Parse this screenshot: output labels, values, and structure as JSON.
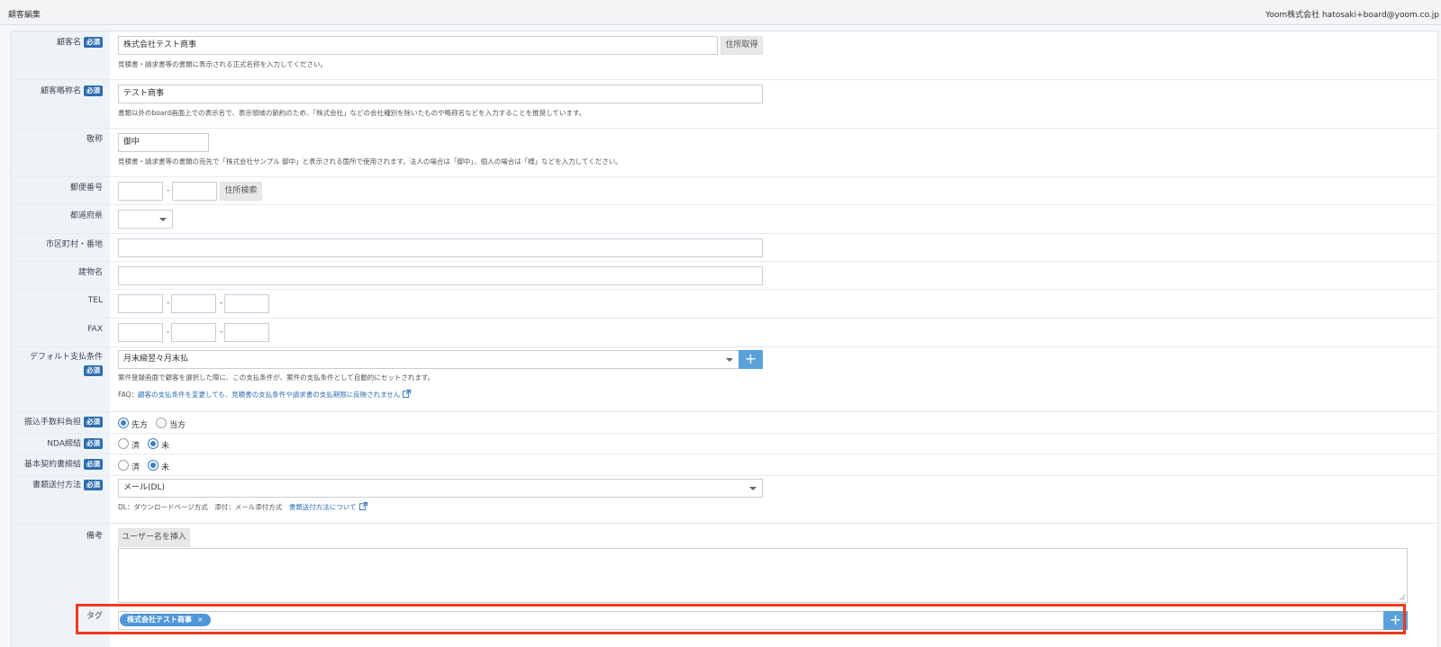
{
  "header": {
    "page_title": "顧客編集",
    "account": "Yoom株式会社 hatosaki+board@yoom.co.jp"
  },
  "required_label": "必須",
  "fields": {
    "customer_name": {
      "label": "顧客名",
      "value": "株式会社テスト商事",
      "button": "住所取得",
      "help": "見積書・請求書等の書類に表示される正式名称を入力してください。"
    },
    "short_name": {
      "label": "顧客略称名",
      "value": "テスト商事",
      "help": "書類以外のboard画面上での表示名で、表示領域の節約のため、「株式会社」などの会社種別を除いたものや略称名などを入力することを推奨しています。"
    },
    "honorific": {
      "label": "敬称",
      "value": "御中",
      "help": "見積書・請求書等の書類の宛先で「株式会社サンプル 御中」と表示される箇所で使用されます。法人の場合は「御中」、個人の場合は「様」などを入力してください。"
    },
    "postal_code": {
      "label": "郵便番号",
      "part1": "",
      "part2": "",
      "dash": "-",
      "button": "住所検索"
    },
    "prefecture": {
      "label": "都道府県",
      "value": ""
    },
    "city_address": {
      "label": "市区町村・番地",
      "value": ""
    },
    "building": {
      "label": "建物名",
      "value": ""
    },
    "tel": {
      "label": "TEL",
      "dash": "-"
    },
    "fax": {
      "label": "FAX",
      "dash": "-"
    },
    "payment_terms": {
      "label": "デフォルト支払条件",
      "value": "月末締翌々月末払",
      "plus": "+",
      "help": "案件登録画面で顧客を選択した際に、この支払条件が、案件の支払条件として自動的にセットされます。",
      "faq_prefix": "FAQ：",
      "faq_link": "顧客の支払条件を変更しても、見積書の支払条件や請求書の支払期限に反映されません"
    },
    "transfer_fee": {
      "label": "振込手数料負担",
      "options": [
        "先方",
        "当方"
      ]
    },
    "nda": {
      "label": "NDA締結",
      "options": [
        "済",
        "未"
      ]
    },
    "basic_contract": {
      "label": "基本契約書締結",
      "options": [
        "済",
        "未"
      ]
    },
    "delivery_method": {
      "label": "書類送付方法",
      "value": "メール(DL)",
      "help": "DL：ダウンロードページ方式　添付：メール添付方式",
      "help_link": "書類送付方法について"
    },
    "notes": {
      "label": "備考",
      "button": "ユーザー名を挿入",
      "value": ""
    },
    "tags": {
      "label": "タグ",
      "items": [
        "株式会社テスト商事"
      ],
      "remove": "×",
      "plus": "+"
    }
  },
  "colors": {
    "required_badge": "#2d6eb0",
    "accent": "#5aa1dc",
    "highlight": "#ee3a1f"
  }
}
